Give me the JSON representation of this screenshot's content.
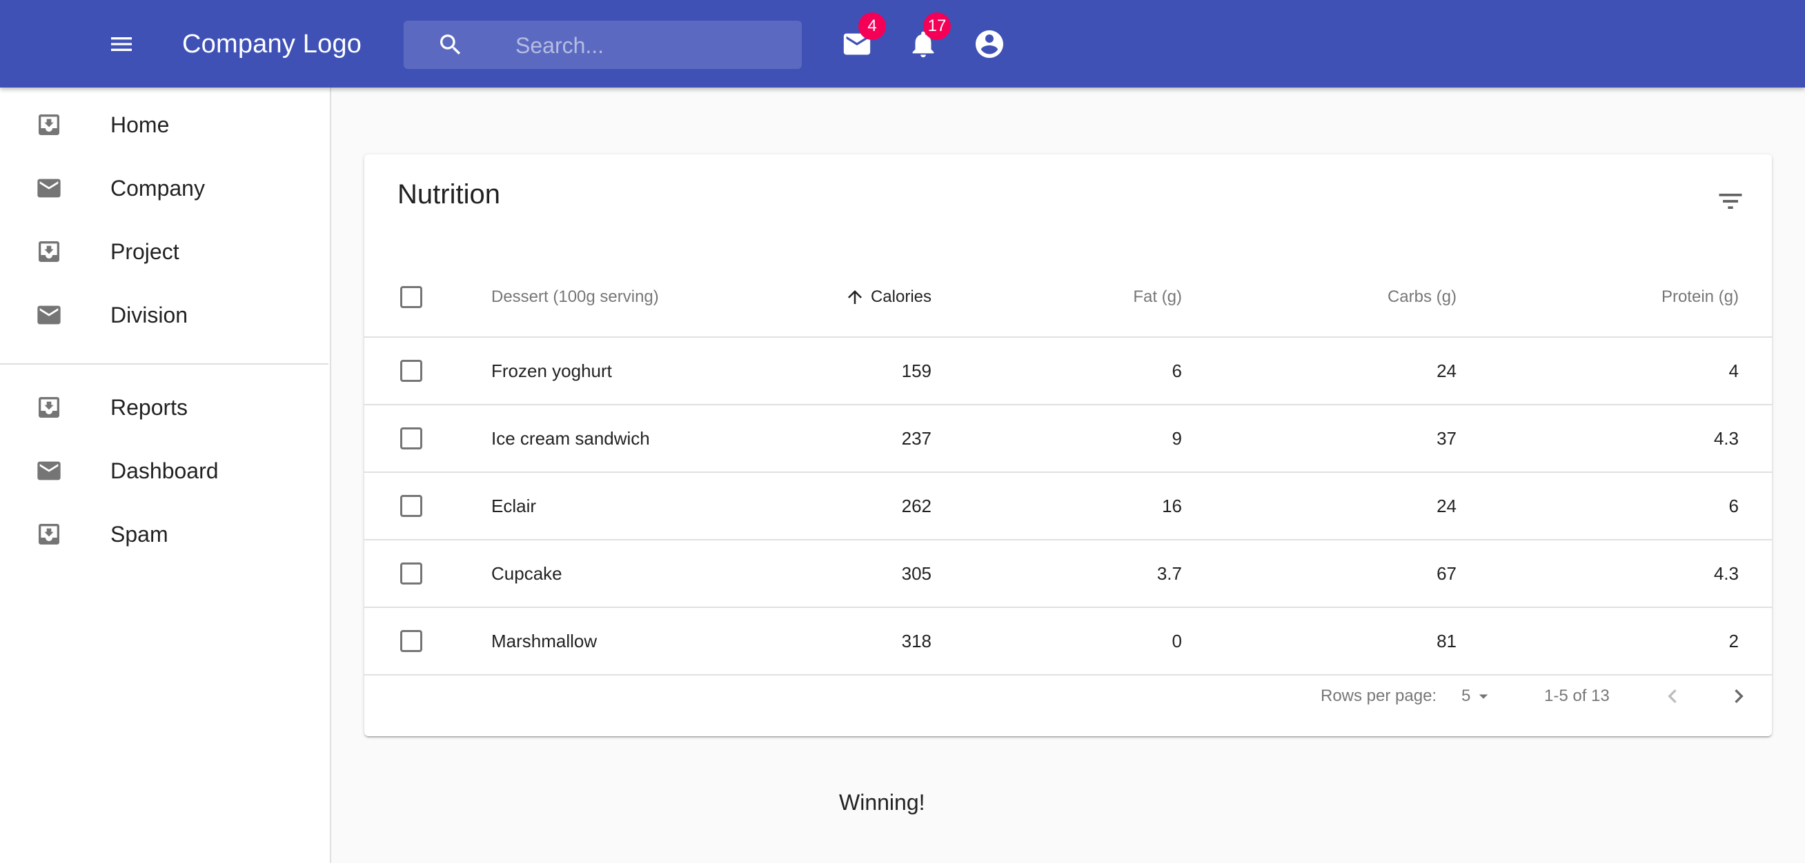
{
  "appbar": {
    "logo": "Company Logo",
    "search_placeholder": "Search...",
    "mail_count": "4",
    "notification_count": "17",
    "bg_color": "#3f51b5",
    "badge_color": "#f50057"
  },
  "drawer": {
    "items": [
      {
        "label": "Home",
        "icon": "move-to-inbox-icon"
      },
      {
        "label": "Company",
        "icon": "mail-icon"
      },
      {
        "label": "Project",
        "icon": "move-to-inbox-icon"
      },
      {
        "label": "Division",
        "icon": "mail-icon"
      }
    ],
    "items2": [
      {
        "label": "Reports",
        "icon": "move-to-inbox-icon"
      },
      {
        "label": "Dashboard",
        "icon": "mail-icon"
      },
      {
        "label": "Spam",
        "icon": "move-to-inbox-icon"
      }
    ]
  },
  "table": {
    "title": "Nutrition",
    "columns": {
      "dessert": "Dessert (100g serving)",
      "calories": "Calories",
      "fat": "Fat (g)",
      "carbs": "Carbs (g)",
      "protein": "Protein (g)"
    },
    "sort_column": "calories",
    "sort_direction": "ascending",
    "rows": [
      {
        "name": "Frozen yoghurt",
        "calories": "159",
        "fat": "6",
        "carbs": "24",
        "protein": "4"
      },
      {
        "name": "Ice cream sandwich",
        "calories": "237",
        "fat": "9",
        "carbs": "37",
        "protein": "4.3"
      },
      {
        "name": "Eclair",
        "calories": "262",
        "fat": "16",
        "carbs": "24",
        "protein": "6"
      },
      {
        "name": "Cupcake",
        "calories": "305",
        "fat": "3.7",
        "carbs": "67",
        "protein": "4.3"
      },
      {
        "name": "Marshmallow",
        "calories": "318",
        "fat": "0",
        "carbs": "81",
        "protein": "2"
      }
    ],
    "pagination": {
      "rows_per_page_label": "Rows per page:",
      "rows_per_page_value": "5",
      "range_text": "1-5 of 13"
    }
  },
  "footer_text": "Winning!"
}
